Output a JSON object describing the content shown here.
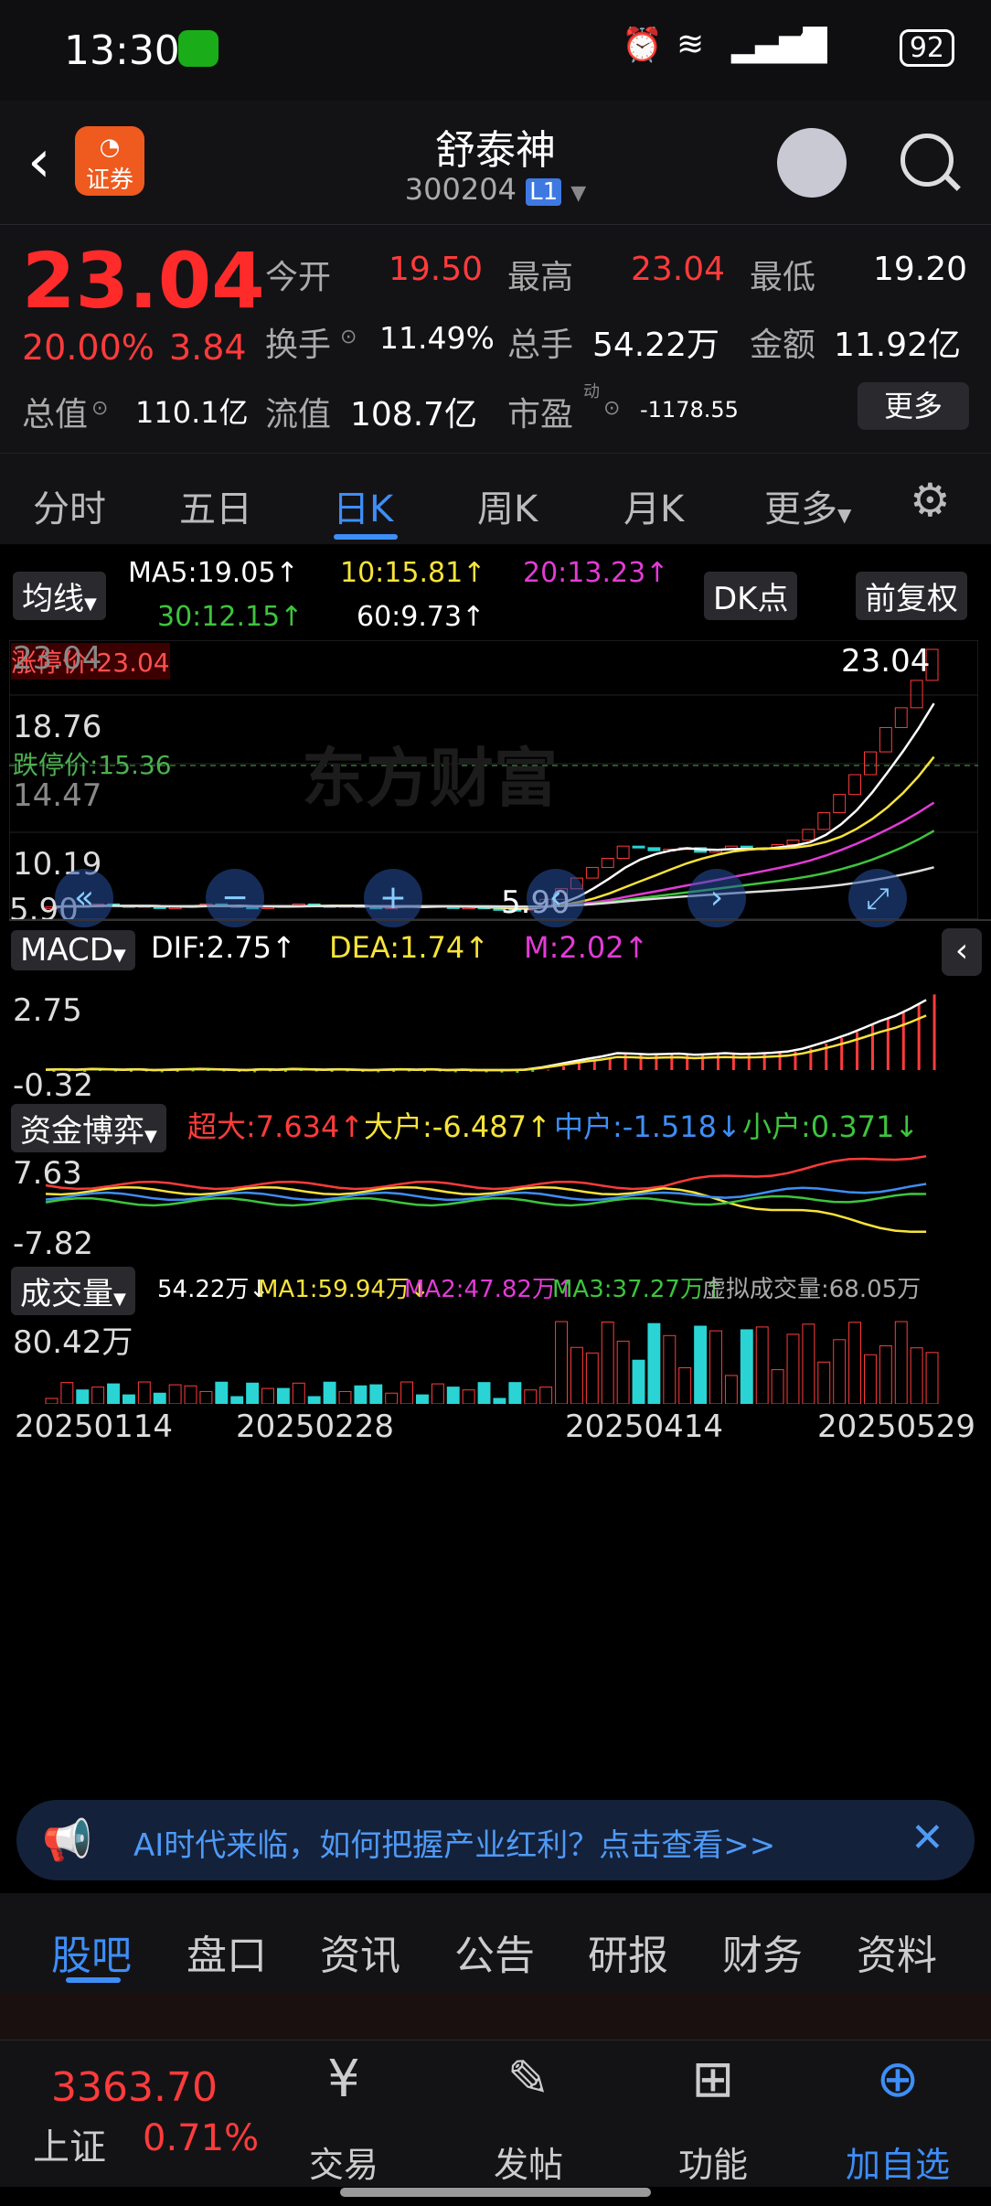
{
  "status_bar": {
    "time": "13:30",
    "signal": "4G",
    "battery": "92"
  },
  "header": {
    "back_icon": "chevron-left-icon",
    "logo_text": "证券",
    "stock_name": "舒泰神",
    "stock_code": "300204",
    "level_badge": "L1"
  },
  "quote": {
    "price": "23.04",
    "change_pct": "20.00%",
    "change": "3.84",
    "open_label": "今开",
    "open": "19.50",
    "high_label": "最高",
    "high": "23.04",
    "low_label": "最低",
    "low": "19.20",
    "turnover_label": "换手",
    "turnover": "11.49%",
    "volume_label": "总手",
    "volume": "54.22万",
    "amount_label": "金额",
    "amount": "11.92亿",
    "mktcap_label": "总值",
    "mktcap": "110.1亿",
    "float_label": "流值",
    "float_cap": "108.7亿",
    "pe_label": "市盈",
    "pe_sup": "动",
    "pe": "-1178.55",
    "more_button": "更多"
  },
  "k_tabs": [
    "分时",
    "五日",
    "日K",
    "周K",
    "月K",
    "更多"
  ],
  "k_tab_active": "日K",
  "ma_panel": {
    "selector": "均线",
    "ma5": "MA5:19.05↑",
    "ma10": "10:15.81↑",
    "ma20": "20:13.23↑",
    "ma30": "30:12.15↑",
    "ma60": "60:9.73↑",
    "dk_button": "DK点",
    "fq_button": "前复权"
  },
  "main_chart": {
    "y_labels": [
      "23.04",
      "18.76",
      "14.47",
      "10.19",
      "5.90"
    ],
    "limit_up": "涨停价:23.04",
    "limit_down": "跌停价:15.36",
    "price_right_label": "23.04",
    "low_label": "5.90",
    "watermark": "东方财富"
  },
  "macd_panel": {
    "selector": "MACD",
    "dif": "DIF:2.75↑",
    "dea": "DEA:1.74↑",
    "m": "M:2.02↑",
    "top": "2.75",
    "bottom": "-0.32"
  },
  "fund_panel": {
    "selector": "资金博弈",
    "super": "超大:7.634↑",
    "big": "大户:-6.487↑",
    "mid": "中户:-1.518↓",
    "small": "小户:0.371↓",
    "top": "7.63",
    "bottom": "-7.82"
  },
  "volume_panel": {
    "selector": "成交量",
    "vol": "54.22万↓",
    "ma1": "MA1:59.94万↓",
    "ma2": "MA2:47.82万↑",
    "ma3": "MA3:37.27万↑",
    "virtual": "虚拟成交量:68.05万",
    "top": "80.42万"
  },
  "x_dates": [
    "20250114",
    "20250228",
    "20250414",
    "20250529"
  ],
  "banner": {
    "text": "AI时代来临，如何把握产业红利？点击查看>>"
  },
  "sub_tabs": [
    "股吧",
    "盘口",
    "资讯",
    "公告",
    "研报",
    "财务",
    "资料"
  ],
  "bottom_nav": {
    "index_value": "3363.70",
    "index_name": "上证",
    "index_change": "0.71%",
    "items": [
      "交易",
      "发帖",
      "功能",
      "加自选"
    ]
  },
  "chart_data": {
    "type": "candlestick",
    "y_range": [
      5.9,
      23.04
    ],
    "series": [
      {
        "name": "MA5",
        "last": 19.05
      },
      {
        "name": "MA10",
        "last": 15.81
      },
      {
        "name": "MA20",
        "last": 13.23
      },
      {
        "name": "MA30",
        "last": 12.15
      },
      {
        "name": "MA60",
        "last": 9.73
      }
    ],
    "closes": [
      6.1,
      6.2,
      6.1,
      6.3,
      6.2,
      6.1,
      6.2,
      6.0,
      6.1,
      6.2,
      6.3,
      6.2,
      6.1,
      6.0,
      6.2,
      6.1,
      6.3,
      6.2,
      6.1,
      6.2,
      6.1,
      6.0,
      6.1,
      6.2,
      6.1,
      6.2,
      6.0,
      6.1,
      6.0,
      5.95,
      5.9,
      6.1,
      6.6,
      7.3,
      8.0,
      8.7,
      9.3,
      10.1,
      10.0,
      9.8,
      9.9,
      10.0,
      9.7,
      9.9,
      10.1,
      9.9,
      10.0,
      10.2,
      10.5,
      11.2,
      12.3,
      13.5,
      14.8,
      16.3,
      17.9,
      19.2,
      21.0,
      23.04
    ],
    "macd": {
      "dif": 2.75,
      "dea": 1.74,
      "m": 2.02
    },
    "x_dates": [
      "20250114",
      "20250228",
      "20250414",
      "20250529"
    ]
  }
}
